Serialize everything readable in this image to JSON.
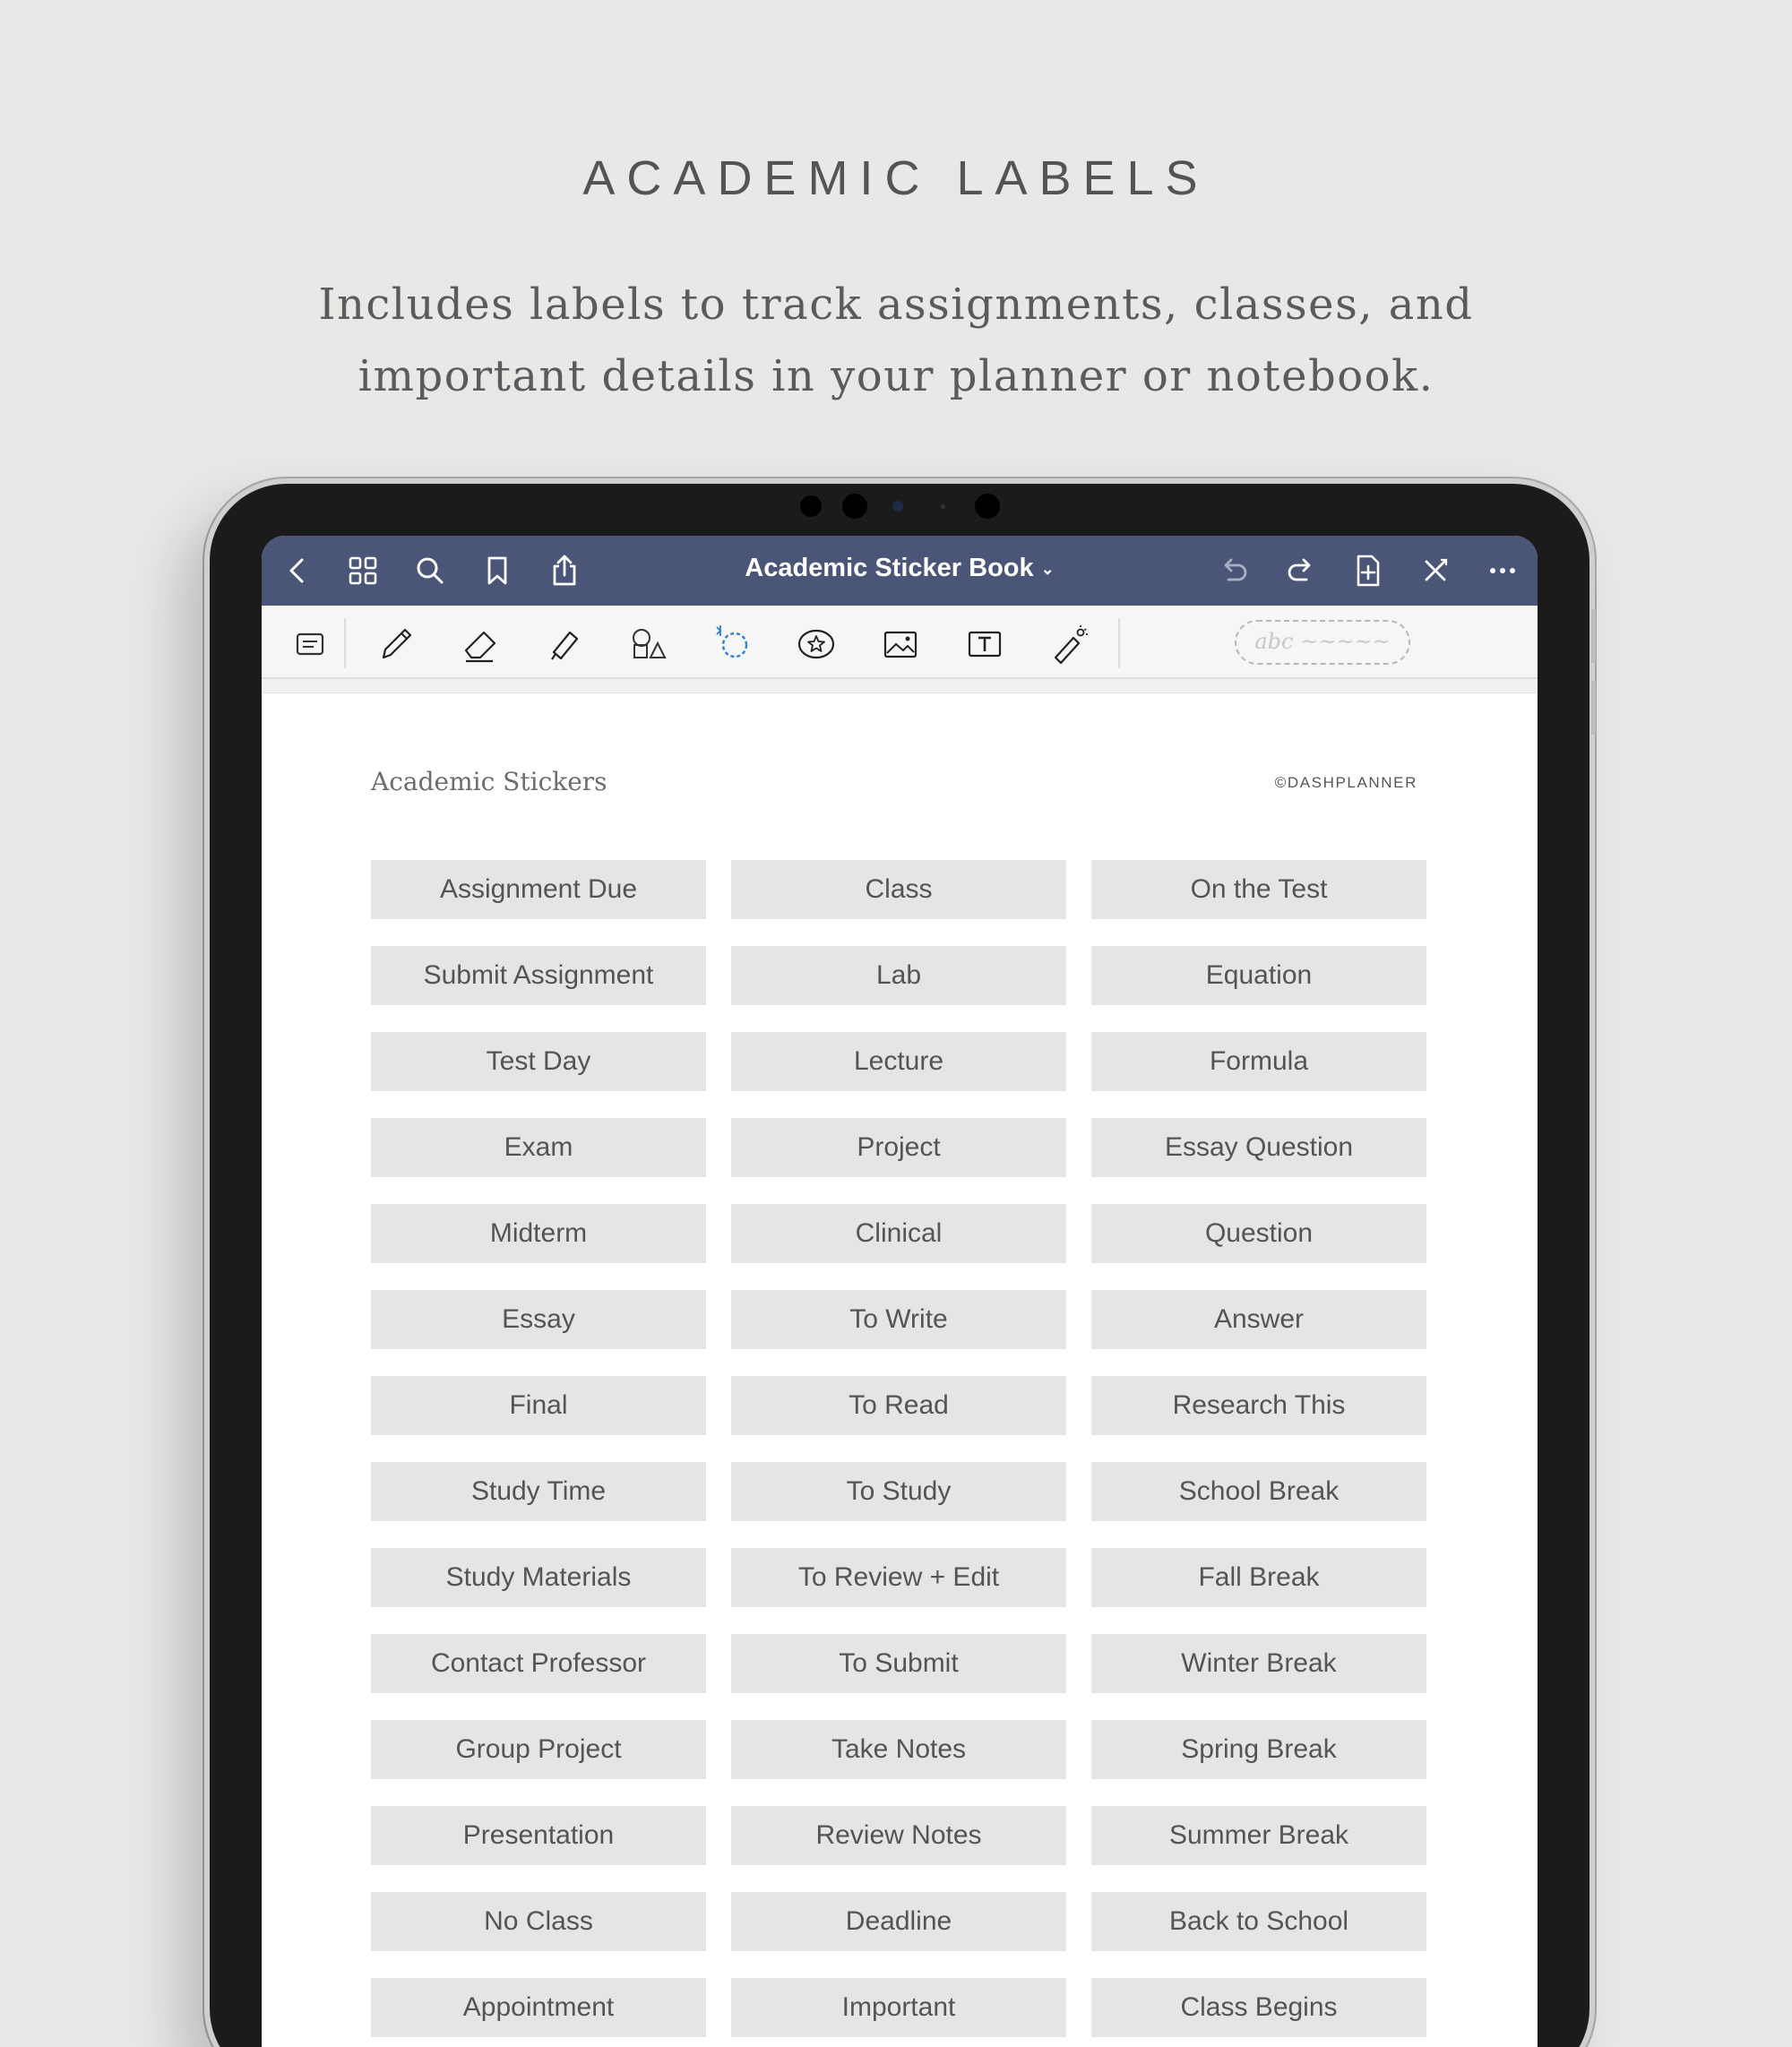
{
  "hero": {
    "title": "ACADEMIC LABELS",
    "subtitle_line1": "Includes labels to track assignments, classes, and",
    "subtitle_line2": "important details in your planner or notebook."
  },
  "app": {
    "document_title": "Academic Sticker Book",
    "nav_left": [
      "back-icon",
      "grid-icon",
      "search-icon",
      "bookmark-icon",
      "share-icon"
    ],
    "nav_right": [
      "undo-icon",
      "redo-icon",
      "add-page-icon",
      "close-icon",
      "more-icon"
    ],
    "tools": [
      "read-mode-icon",
      "pen-icon",
      "eraser-icon",
      "highlighter-icon",
      "shapes-icon",
      "lasso-icon",
      "sticker-icon",
      "image-icon",
      "text-box-icon",
      "laser-pointer-icon"
    ],
    "pen_preview": "abc ~~~~~",
    "colors": {
      "navbar": "#4a5578",
      "lasso": "#2f7fd1"
    }
  },
  "page": {
    "title": "Academic Stickers",
    "copyright": "©DASHPLANNER",
    "labels": [
      [
        "Assignment Due",
        "Class",
        "On the Test"
      ],
      [
        "Submit Assignment",
        "Lab",
        "Equation"
      ],
      [
        "Test Day",
        "Lecture",
        "Formula"
      ],
      [
        "Exam",
        "Project",
        "Essay Question"
      ],
      [
        "Midterm",
        "Clinical",
        "Question"
      ],
      [
        "Essay",
        "To Write",
        "Answer"
      ],
      [
        "Final",
        "To Read",
        "Research This"
      ],
      [
        "Study Time",
        "To Study",
        "School Break"
      ],
      [
        "Study Materials",
        "To Review + Edit",
        "Fall Break"
      ],
      [
        "Contact Professor",
        "To Submit",
        "Winter Break"
      ],
      [
        "Group Project",
        "Take Notes",
        "Spring Break"
      ],
      [
        "Presentation",
        "Review Notes",
        "Summer Break"
      ],
      [
        "No Class",
        "Deadline",
        "Back to School"
      ],
      [
        "Appointment",
        "Important",
        "Class Begins"
      ]
    ]
  }
}
